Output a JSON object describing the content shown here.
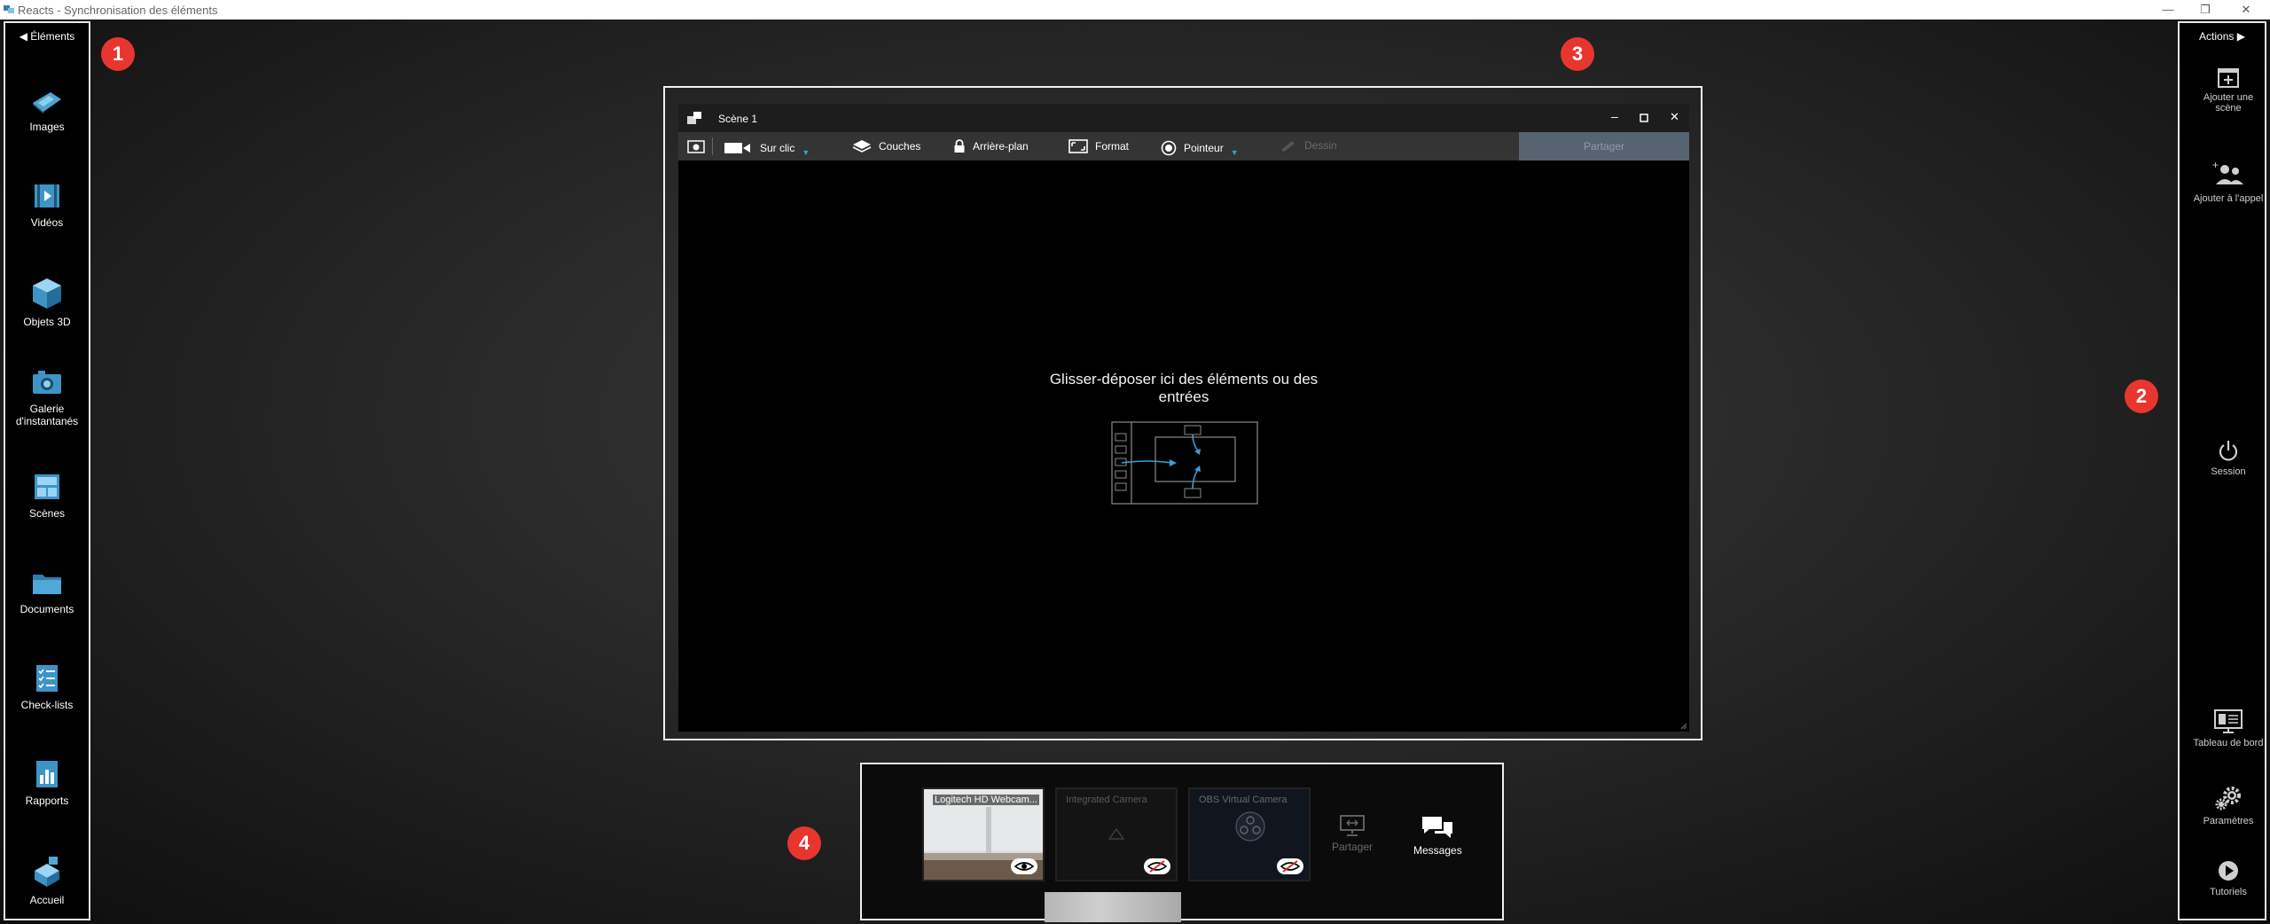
{
  "window": {
    "title": "Reacts - Synchronisation des éléments",
    "minimize_glyph": "—",
    "restore_glyph": "❐",
    "close_glyph": "✕"
  },
  "left_sidebar": {
    "header": "Éléments",
    "items": [
      {
        "label": "Images",
        "icon": "images-icon"
      },
      {
        "label": "Vidéos",
        "icon": "videos-icon"
      },
      {
        "label": "Objets 3D",
        "icon": "cube-icon"
      },
      {
        "label_line1": "Galerie",
        "label_line2": "d'instantanés",
        "icon": "camera-icon"
      },
      {
        "label": "Scènes",
        "icon": "scenes-icon"
      },
      {
        "label": "Documents",
        "icon": "folder-icon"
      },
      {
        "label": "Check-lists",
        "icon": "checklist-icon"
      },
      {
        "label": "Rapports",
        "icon": "reports-icon"
      },
      {
        "label": "Accueil",
        "icon": "home-icon"
      }
    ]
  },
  "right_sidebar": {
    "header": "Actions",
    "items": [
      {
        "label_line1": "Ajouter une",
        "label_line2": "scène",
        "icon": "add-scene-icon"
      },
      {
        "label": "Ajouter à l'appel",
        "icon": "add-people-icon"
      },
      {
        "label": "Session",
        "icon": "power-icon"
      },
      {
        "label": "Tableau de bord",
        "icon": "dashboard-icon"
      },
      {
        "label": "Paramètres",
        "icon": "gear-icon"
      },
      {
        "label": "Tutoriels",
        "icon": "play-icon"
      }
    ]
  },
  "badges": [
    "1",
    "2",
    "3",
    "4"
  ],
  "scene": {
    "title": "Scène 1",
    "toolbar": {
      "sur_clic": "Sur clic",
      "couches": "Couches",
      "arriere_plan": "Arrière-plan",
      "format": "Format",
      "pointeur": "Pointeur",
      "dessin": "Dessin",
      "partager": "Partager"
    },
    "drop_text_line1": "Glisser-déposer ici des éléments ou des",
    "drop_text_line2": "entrées"
  },
  "bottom_panel": {
    "cameras": [
      {
        "label": "Logitech HD Webcam...",
        "state": "visible",
        "icon": "eye-icon"
      },
      {
        "label": "Integrated Camera",
        "state": "hidden",
        "icon": "eye-off-icon"
      },
      {
        "label": "OBS Virtual Camera",
        "state": "hidden",
        "icon": "eye-off-icon"
      }
    ],
    "share_label": "Partager",
    "messages_label": "Messages"
  },
  "colors": {
    "accent_blue": "#3aa0d8",
    "badge_red": "#e8362f",
    "partager_bg": "#556470"
  }
}
